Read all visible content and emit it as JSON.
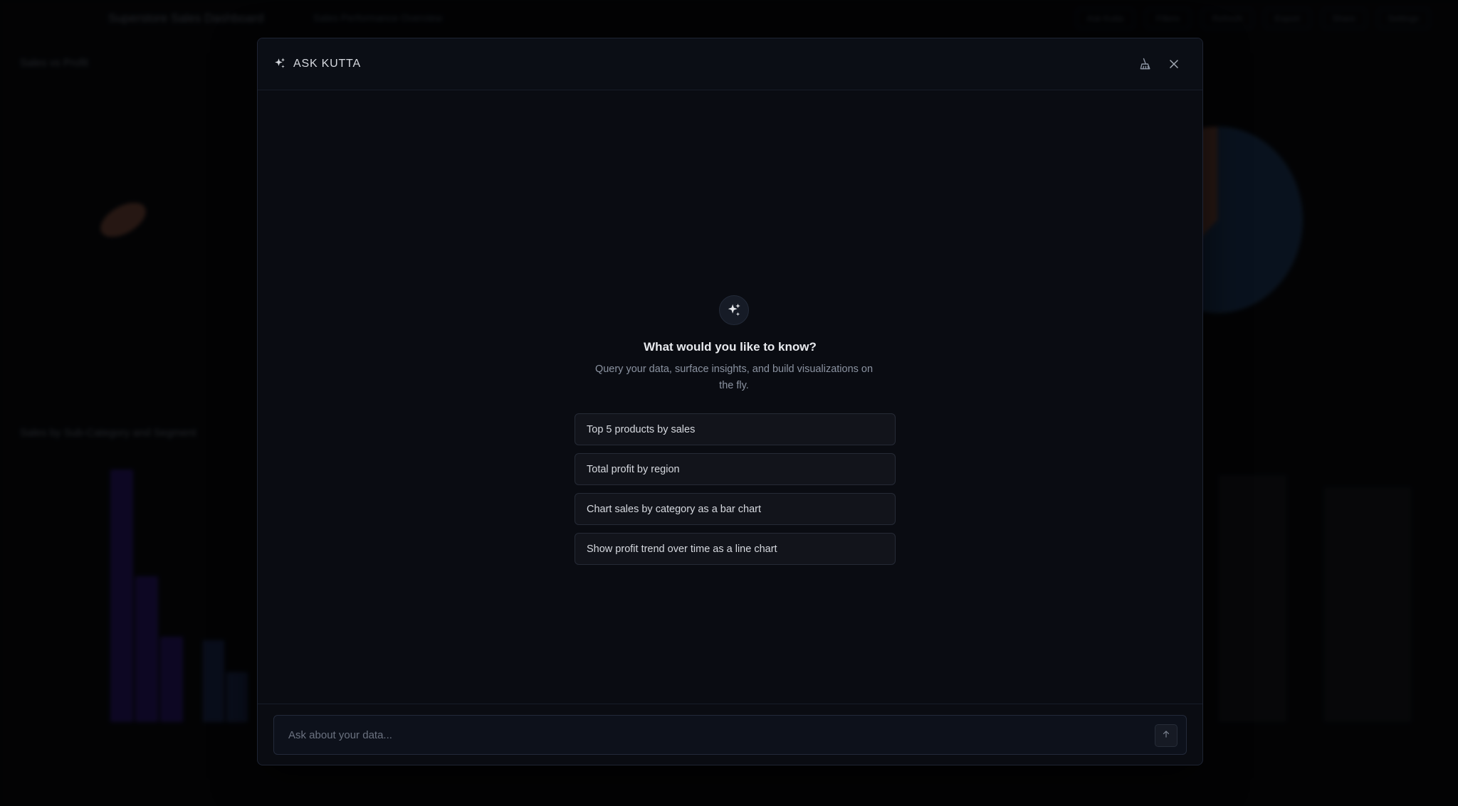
{
  "background": {
    "app_title": "Superstore Sales Dashboard",
    "app_subtitle": "Sales Performance Overview",
    "toolbar_buttons": [
      "Ask Kutta",
      "Filters",
      "Refresh",
      "Export",
      "Share",
      "Settings"
    ],
    "cards": {
      "scatter_title": "Sales vs Profit",
      "bar_title": "Sales by Sub-Category and Segment"
    }
  },
  "modal": {
    "title": "ASK KUTTA",
    "icons": {
      "title": "sparkles-icon",
      "clear": "broom-icon",
      "close": "close-icon",
      "hero": "sparkles-icon",
      "send": "arrow-up-icon"
    },
    "empty_state": {
      "heading": "What would you like to know?",
      "subtext": "Query your data, surface insights, and build visualizations on the fly."
    },
    "suggestions": [
      {
        "label": "Top 5 products by sales"
      },
      {
        "label": "Total profit by region"
      },
      {
        "label": "Chart sales by category as a bar chart"
      },
      {
        "label": "Show profit trend over time as a line chart"
      }
    ],
    "composer": {
      "placeholder": "Ask about your data...",
      "value": ""
    }
  },
  "colors": {
    "accent_purple": "#3b1f8a",
    "accent_blue": "#1e3a5f"
  }
}
